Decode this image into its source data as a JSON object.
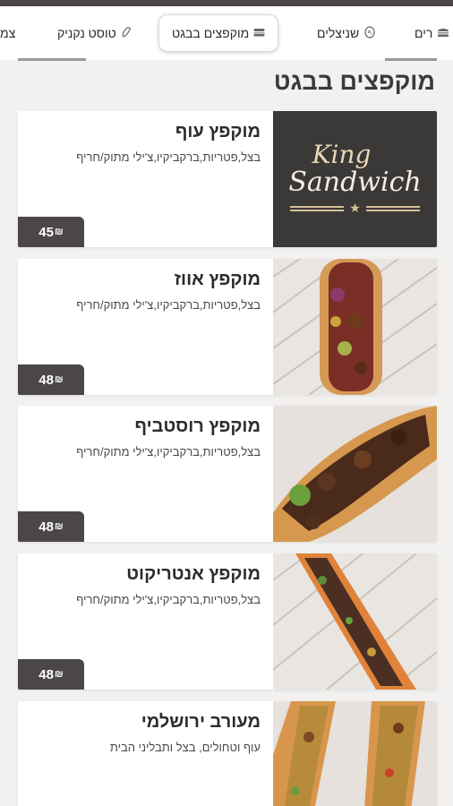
{
  "nav": {
    "tabs": [
      {
        "label": "צמ",
        "icon": ""
      },
      {
        "label": "טוסט נקניק",
        "icon": "sausage-icon"
      },
      {
        "label": "מוקפצים בבגט",
        "icon": "sandwich-icon",
        "active": true
      },
      {
        "label": "שניצלים",
        "icon": "schnitzel-icon"
      },
      {
        "label": "רים",
        "icon": "burger-icon"
      }
    ]
  },
  "section": {
    "title": "מוקפצים בבגט"
  },
  "items": [
    {
      "name": "מוקפץ עוף",
      "desc": "בצל,פטריות,ברקביקיו,צ'ילי מתוק/חריף",
      "price": "45",
      "currency": "₪",
      "image": "king-sandwich-logo"
    },
    {
      "name": "מוקפץ אווז",
      "desc": "בצל,פטריות,ברקביקיו,צ'ילי מתוק/חריף",
      "price": "48",
      "currency": "₪",
      "image": "baguette-photo"
    },
    {
      "name": "מוקפץ רוסטביף",
      "desc": "בצל,פטריות,ברקביקיו,צ'ילי מתוק/חריף",
      "price": "48",
      "currency": "₪",
      "image": "baguette-photo"
    },
    {
      "name": "מוקפץ אנטריקוט",
      "desc": "בצל,פטריות,ברקביקיו,צ'ילי מתוק/חריף",
      "price": "48",
      "currency": "₪",
      "image": "baguette-photo"
    },
    {
      "name": "מעורב ירושלמי",
      "desc": "עוף וטחולים, בצל ותבליני הבית",
      "price": "",
      "currency": "",
      "image": "baguette-photo"
    }
  ],
  "logo": {
    "line1": "King",
    "line2": "Sandwich"
  },
  "colors": {
    "dark": "#4b4746",
    "accent": "#d6c296"
  }
}
